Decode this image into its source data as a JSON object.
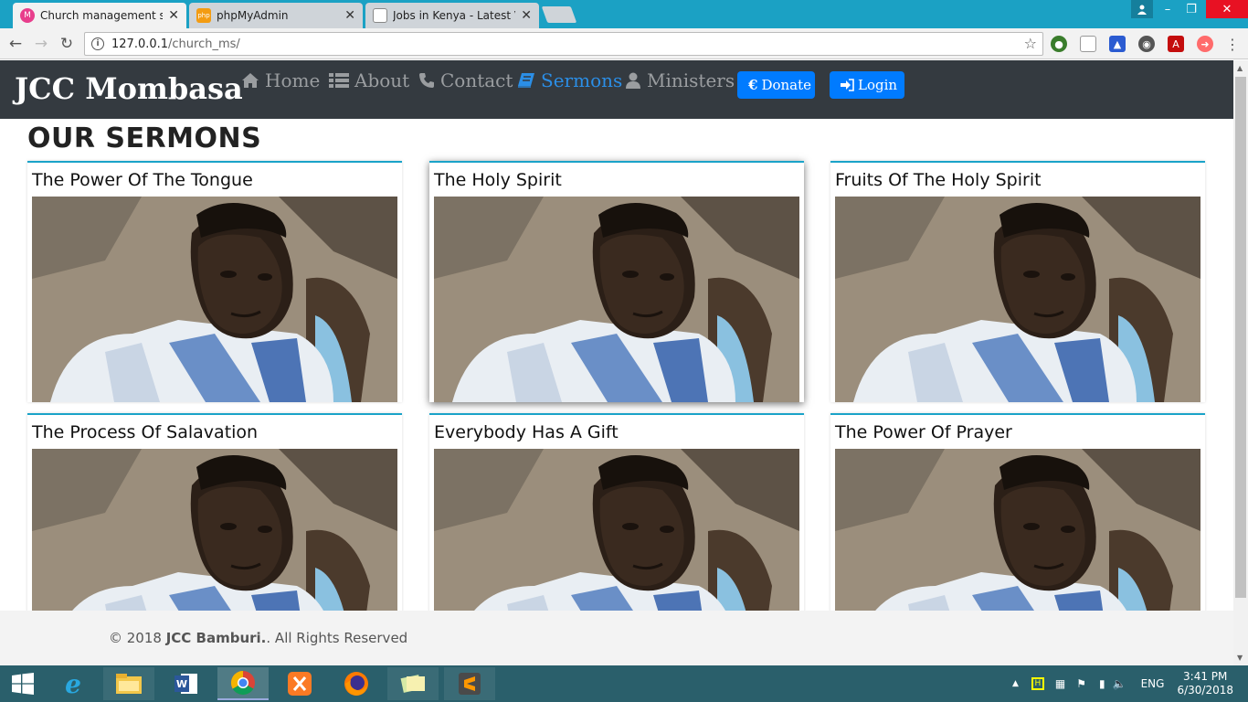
{
  "browser": {
    "tabs": [
      {
        "title": "Church management syst",
        "favicon": "church-m-icon",
        "active": true
      },
      {
        "title": "phpMyAdmin",
        "favicon": "phpmyadmin-icon",
        "active": false
      },
      {
        "title": "Jobs in Kenya - Latest Va",
        "favicon": "page-icon",
        "active": false
      }
    ],
    "address": {
      "host": "127.0.0.1",
      "path": "/church_ms/"
    }
  },
  "site": {
    "brand": "JCC Mombasa",
    "nav": [
      {
        "label": "Home",
        "icon": "home-icon"
      },
      {
        "label": "About",
        "icon": "list-icon"
      },
      {
        "label": "Contact",
        "icon": "phone-icon"
      },
      {
        "label": "Sermons",
        "icon": "book-icon",
        "active": true
      },
      {
        "label": "Ministers",
        "icon": "user-icon"
      }
    ],
    "buttons": {
      "donate": "Donate",
      "donate_symbol": "€",
      "login": "Login"
    },
    "heading": "OUR SERMONS",
    "sermons": [
      {
        "title": "The Power Of The Tongue"
      },
      {
        "title": "The Holy Spirit"
      },
      {
        "title": "Fruits Of The Holy Spirit"
      },
      {
        "title": "The Process Of Salavation"
      },
      {
        "title": "Everybody Has A Gift"
      },
      {
        "title": "The Power Of Prayer"
      }
    ],
    "footer": {
      "prefix": "© 2018 ",
      "org": "JCC Bamburi.",
      "suffix": ". All Rights Reserved"
    }
  },
  "taskbar": {
    "apps": [
      "windows-start-icon",
      "internet-explorer-icon",
      "file-explorer-icon",
      "word-icon",
      "chrome-icon",
      "xampp-icon",
      "firefox-icon",
      "notes-icon",
      "sublime-text-icon"
    ],
    "language": "ENG",
    "time": "3:41 PM",
    "date": "6/30/2018"
  },
  "colors": {
    "navbar": "#343a40",
    "accent": "#007bff",
    "active_link": "#2b8ee6",
    "card_border": "#1aa3c8"
  }
}
